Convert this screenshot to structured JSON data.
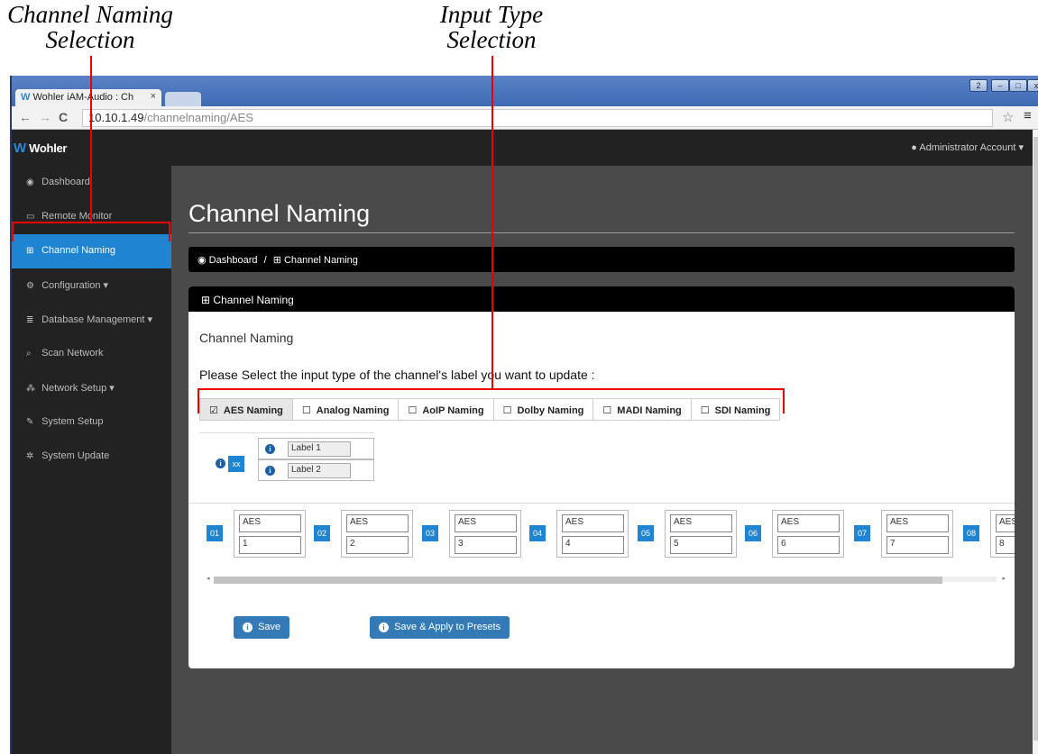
{
  "annotations": {
    "left_caption": "Channel Naming\nSelection",
    "right_caption": "Input Type\nSelection"
  },
  "browser": {
    "tab_title": "Wohler iAM-Audio : Ch",
    "tab_close": "×",
    "url_host": "10.10.1.49",
    "url_path": "/channelnaming/AES",
    "controls": [
      "2",
      "–",
      "□",
      "x"
    ]
  },
  "appbar": {
    "logo": "Wohler",
    "account": "Administrator Account"
  },
  "sidebar": {
    "items": [
      {
        "icon": "dashboard-icon",
        "glyph": "◉",
        "label": "Dashboard"
      },
      {
        "icon": "monitor-icon",
        "glyph": "▭",
        "label": "Remote Monitor"
      },
      {
        "icon": "table-icon",
        "glyph": "⊞",
        "label": "Channel Naming",
        "active": true
      },
      {
        "icon": "cogs-icon",
        "glyph": "⚙",
        "label": "Configuration ▾"
      },
      {
        "icon": "database-icon",
        "glyph": "≣",
        "label": "Database Management ▾"
      },
      {
        "icon": "search-icon",
        "glyph": "⌕",
        "label": "Scan Network"
      },
      {
        "icon": "sitemap-icon",
        "glyph": "⁂",
        "label": "Network Setup ▾"
      },
      {
        "icon": "wrench-icon",
        "glyph": "✎",
        "label": "System Setup"
      },
      {
        "icon": "gear-icon",
        "glyph": "✲",
        "label": "System Update"
      }
    ]
  },
  "main": {
    "title": "Channel Naming",
    "breadcrumb": {
      "home": "Dashboard",
      "separator": "/",
      "current": "Channel Naming"
    },
    "panel_title": "Channel Naming",
    "panel_subtitle": "Channel Naming",
    "prompt": "Please Select the input type of the channel's label you want to update :",
    "input_types": [
      {
        "label": "AES Naming",
        "checked": true
      },
      {
        "label": "Analog Naming",
        "checked": false
      },
      {
        "label": "AoIP Naming",
        "checked": false
      },
      {
        "label": "Dolby Naming",
        "checked": false
      },
      {
        "label": "MADI Naming",
        "checked": false
      },
      {
        "label": "SDI Naming",
        "checked": false
      }
    ],
    "legend": {
      "tag": "xx",
      "label1": "Label 1",
      "label2": "Label 2"
    },
    "channels": [
      {
        "num": "01",
        "label1": "AES",
        "label2": "1"
      },
      {
        "num": "02",
        "label1": "AES",
        "label2": "2"
      },
      {
        "num": "03",
        "label1": "AES",
        "label2": "3"
      },
      {
        "num": "04",
        "label1": "AES",
        "label2": "4"
      },
      {
        "num": "05",
        "label1": "AES",
        "label2": "5"
      },
      {
        "num": "06",
        "label1": "AES",
        "label2": "6"
      },
      {
        "num": "07",
        "label1": "AES",
        "label2": "7"
      },
      {
        "num": "08",
        "label1": "AES",
        "label2": "8"
      }
    ],
    "save_label": "Save",
    "save_apply_label": "Save & Apply to Presets"
  }
}
